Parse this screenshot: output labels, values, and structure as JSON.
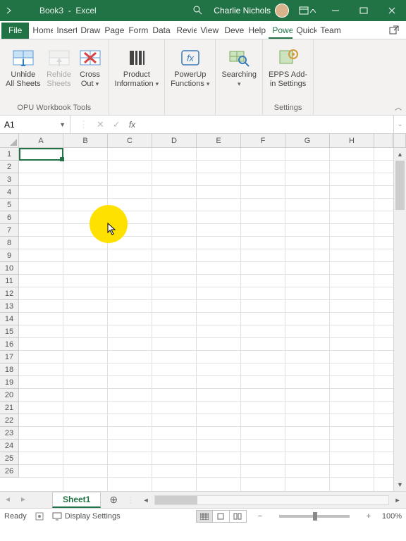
{
  "titlebar": {
    "filename": "Book3",
    "appname": "Excel",
    "username": "Charlie Nichols"
  },
  "tabs": {
    "file": "File",
    "items": [
      "Home",
      "Insert",
      "Draw",
      "Page",
      "Form",
      "Data",
      "Review",
      "View",
      "Developer",
      "Help",
      "PowerUp",
      "Quick",
      "Team"
    ],
    "active_index": 10
  },
  "ribbon": {
    "group1_caption": "OPU Workbook Tools",
    "group5_caption": "Settings",
    "btn_unhide": "Unhide\nAll Sheets",
    "btn_rehide": "Rehide\nSheets",
    "btn_cross": "Cross\nOut",
    "btn_prodinfo": "Product\nInformation",
    "btn_powerup": "PowerUp\nFunctions",
    "btn_searching": "Searching",
    "btn_epps": "EPPS Add-\nin Settings"
  },
  "formula_bar": {
    "namebox": "A1",
    "formula": ""
  },
  "grid": {
    "columns": [
      "A",
      "B",
      "C",
      "D",
      "E",
      "F",
      "G",
      "H"
    ],
    "rows": 26,
    "active_cell": "A1"
  },
  "sheet": {
    "active": "Sheet1"
  },
  "status": {
    "mode": "Ready",
    "display_settings": "Display Settings",
    "zoom_label": "100%"
  },
  "highlight": {
    "note": "yellow circular highlight with cursor near B4/B5"
  }
}
